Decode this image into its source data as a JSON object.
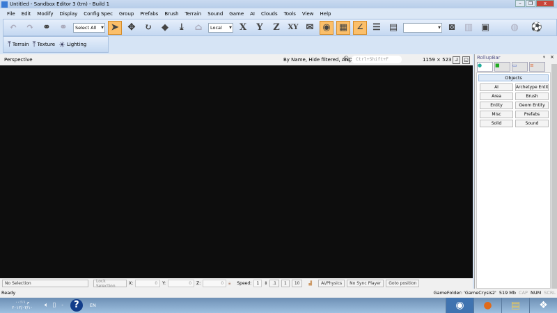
{
  "window": {
    "title": "Untitled - Sandbox Editor 3 (tm) - Build 1",
    "minimize": "–",
    "maximize": "❐",
    "close": "x"
  },
  "menu": [
    "File",
    "Edit",
    "Modify",
    "Display",
    "Config Spec",
    "Group",
    "Prefabs",
    "Brush",
    "Terrain",
    "Sound",
    "Game",
    "AI",
    "Clouds",
    "Tools",
    "View",
    "Help"
  ],
  "toolbar": {
    "selection_filter": "Select All",
    "coord_system": "Local",
    "axis_x": "X",
    "axis_y": "Y",
    "axis_z": "Z",
    "axis_xy": "XY",
    "layer_combo": ""
  },
  "toolbar2": {
    "terrain": "Terrain",
    "texture": "Texture",
    "lighting": "Lighting"
  },
  "viewport": {
    "name": "Perspective",
    "filter_text": "By Name, Hide filtered, AND",
    "search_placeholder": "Ctrl+Shift+F",
    "resolution": "1159 × 523"
  },
  "rollup": {
    "title": "RollupBar",
    "pin": "ᵠ",
    "close": "×",
    "header": "Objects",
    "buttons": [
      "AI",
      "Archetype Entity",
      "Area",
      "Brush",
      "Entity",
      "Geom Entity",
      "Misc",
      "Prefabs",
      "Solid",
      "Sound"
    ]
  },
  "status": {
    "selection": "No Selection",
    "lock": "Lock Selection",
    "x_label": "X:",
    "x": "0",
    "y_label": "Y:",
    "y": "0",
    "z_label": "Z:",
    "z": "0",
    "speed_label": "Speed:",
    "speed": "1",
    "speed_opts": [
      ".1",
      "1",
      "10"
    ],
    "ai_physics": "AI/Physics",
    "sync": "No Sync Player",
    "goto": "Goto position"
  },
  "statusline": {
    "ready": "Ready",
    "game_folder": "GameFolder: 'GameCrysis2'",
    "memory": "519 Mb",
    "cap": "CAP",
    "num": "NUM",
    "scrl": "SCRL"
  },
  "taskbar": {
    "time": "۰۰:۱۱ م",
    "date": "۲۰۱۲/۰۳/۱۰",
    "lang": "EN"
  }
}
